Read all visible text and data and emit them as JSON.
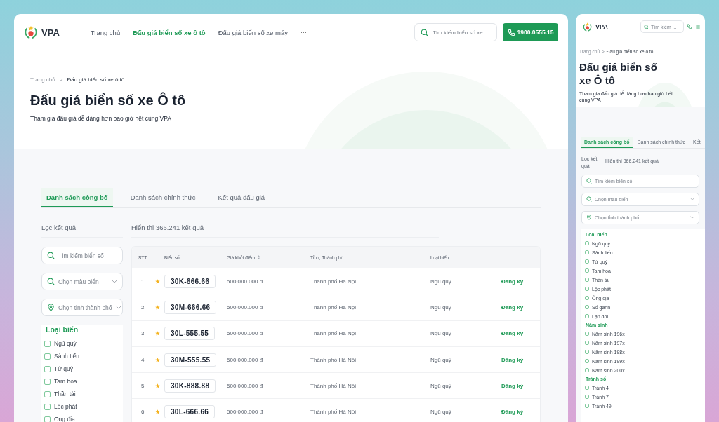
{
  "desktop": {
    "header": {
      "logo": "VPA",
      "nav": [
        {
          "label": "Trang chủ",
          "selected": false
        },
        {
          "label": "Đấu giá biển số xe ô tô",
          "selected": true
        },
        {
          "label": "Đấu giá biển số xe máy",
          "selected": false
        }
      ],
      "more": "···",
      "search_placeholder": "Tìm kiếm biển số xe",
      "phone": "1900.0555.15"
    },
    "breadcrumb": [
      "Trang chủ",
      "Đấu giá biển số xe ô tô"
    ],
    "breadcrumb_separator": ">",
    "title": "Đấu giá biển số xe Ô tô",
    "subtitle": "Tham gia đấu giá dễ dàng hơn bao giờ hết cùng VPA",
    "tabs": [
      {
        "label": "Danh sách công bố",
        "selected": true
      },
      {
        "label": "Danh sách chính thức",
        "selected": false
      },
      {
        "label": "Kết quả đấu giá",
        "selected": false
      }
    ],
    "filter_title": "Lọc kết quả",
    "result_count": "Hiển thị 366.241 kết quả",
    "filters": {
      "search_placeholder": "Tìm kiếm biển số",
      "color_placeholder": "Chọn màu biển",
      "city_placeholder": "Chọn tỉnh thành phố",
      "groups": [
        {
          "title": "Loại biển",
          "options": [
            {
              "label": "Ngũ quý",
              "checked": false
            },
            {
              "label": "Sảnh tiến",
              "checked": false
            },
            {
              "label": "Tứ quý",
              "checked": false
            },
            {
              "label": "Tam hoa",
              "checked": false
            },
            {
              "label": "Thần tài",
              "checked": false
            },
            {
              "label": "Lộc phát",
              "checked": false
            },
            {
              "label": "Ông địa",
              "checked": false
            }
          ]
        }
      ]
    },
    "table": {
      "columns": [
        "STT",
        "Biển số",
        "Giá khởi điểm",
        "Tỉnh, Thành phố",
        "Loại biển"
      ],
      "rows": [
        {
          "stt": "1",
          "plate": "30K-666.66",
          "price": "500.000.000 đ",
          "city": "Thành phố Hà Nội",
          "type": "Ngũ quý",
          "action": "Đăng ký"
        },
        {
          "stt": "2",
          "plate": "30M-666.66",
          "price": "500.000.000 đ",
          "city": "Thành phố Hà Nội",
          "type": "Ngũ quý",
          "action": "Đăng ký"
        },
        {
          "stt": "3",
          "plate": "30L-555.55",
          "price": "500.000.000 đ",
          "city": "Thành phố Hà Nội",
          "type": "Ngũ quý",
          "action": "Đăng ký"
        },
        {
          "stt": "4",
          "plate": "30M-555.55",
          "price": "500.000.000 đ",
          "city": "Thành phố Hà Nội",
          "type": "Ngũ quý",
          "action": "Đăng ký"
        },
        {
          "stt": "5",
          "plate": "30K-888.88",
          "price": "500.000.000 đ",
          "city": "Thành phố Hà Nội",
          "type": "Ngũ quý",
          "action": "Đăng ký"
        },
        {
          "stt": "6",
          "plate": "30L-666.66",
          "price": "500.000.000 đ",
          "city": "Thành phố Hà Nội",
          "type": "Ngũ quý",
          "action": "Đăng ký"
        }
      ]
    }
  },
  "mobile": {
    "header": {
      "logo": "VPA",
      "search_placeholder": "Tìm kiếm ..."
    },
    "breadcrumb": [
      "Trang chủ",
      "Đấu giá biển số xe ô tô"
    ],
    "breadcrumb_separator": ">",
    "title": "Đấu giá biển số xe Ô tô",
    "subtitle": "Tham gia đấu giá dễ dàng hơn bao giờ hết cùng VPA",
    "tabs": [
      {
        "label": "Danh sách công bố",
        "selected": true
      },
      {
        "label": "Danh sách chính thức",
        "selected": false
      },
      {
        "label": "Kết",
        "selected": false
      }
    ],
    "filter_title": "Lọc kết quả",
    "result_count": "Hiển thị 366.241 kết quả",
    "filters": {
      "search_placeholder": "Tìm kiếm biển số",
      "color_placeholder": "Chọn màu biển",
      "city_placeholder": "Chọn tỉnh thành phố",
      "groups": [
        {
          "title": "Loại biển",
          "options": [
            {
              "label": "Ngũ quý",
              "checked": false
            },
            {
              "label": "Sảnh tiến",
              "checked": false
            },
            {
              "label": "Tứ quý",
              "checked": false
            },
            {
              "label": "Tam hoa",
              "checked": false
            },
            {
              "label": "Thần tài",
              "checked": false
            },
            {
              "label": "Lộc phát",
              "checked": false
            },
            {
              "label": "Ông địa",
              "checked": false
            },
            {
              "label": "Số gánh",
              "checked": false
            },
            {
              "label": "Lặp đôi",
              "checked": false
            }
          ]
        },
        {
          "title": "Năm sinh",
          "options": [
            {
              "label": "Năm sinh 196x",
              "checked": false
            },
            {
              "label": "Năm sinh 197x",
              "checked": false
            },
            {
              "label": "Năm sinh 198x",
              "checked": false
            },
            {
              "label": "Năm sinh 199x",
              "checked": false
            },
            {
              "label": "Năm sinh 200x",
              "checked": false
            }
          ]
        },
        {
          "title": "Tránh số",
          "options": [
            {
              "label": "Tránh 4",
              "checked": false
            },
            {
              "label": "Tránh 7",
              "checked": false
            },
            {
              "label": "Tránh 49",
              "checked": false
            }
          ]
        }
      ]
    }
  }
}
